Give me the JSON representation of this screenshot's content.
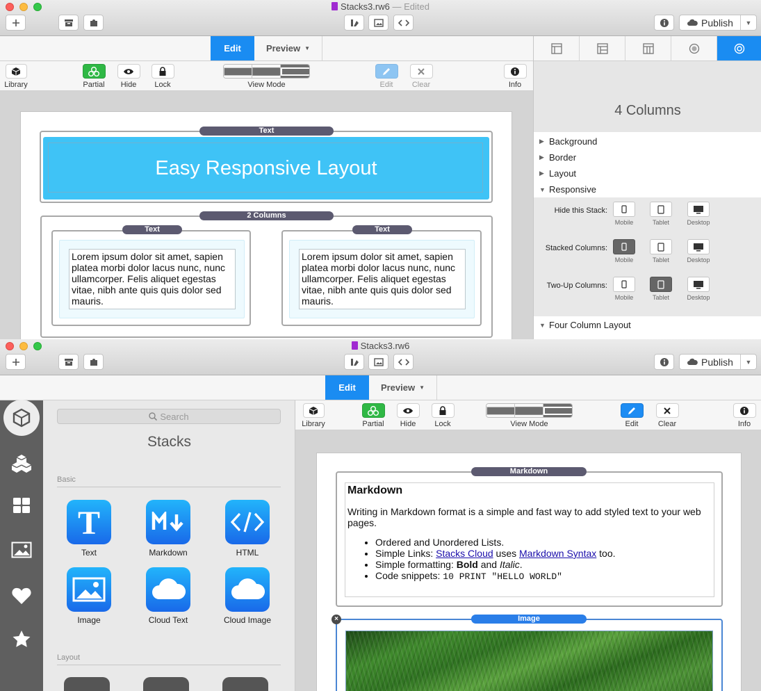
{
  "window1": {
    "title": "Stacks3.rw6",
    "edited": "— Edited",
    "publish": "Publish",
    "tabs": {
      "edit": "Edit",
      "preview": "Preview"
    },
    "toolbar": {
      "library": "Library",
      "partial": "Partial",
      "hide": "Hide",
      "lock": "Lock",
      "view_mode": "View Mode",
      "edit": "Edit",
      "clear": "Clear",
      "info": "Info"
    },
    "canvas": {
      "text_label": "Text",
      "hero_text": "Easy Responsive Layout",
      "columns_label": "2 Columns",
      "col1_label": "Text",
      "col2_label": "Text",
      "lorem": "Lorem ipsum dolor sit amet, sapien platea morbi dolor lacus nunc, nunc ullamcorper. Felis aliquet egestas vitae, nibh ante quis quis dolor sed mauris."
    },
    "inspector": {
      "title": "4 Columns",
      "rows": [
        "Background",
        "Border",
        "Layout",
        "Responsive"
      ],
      "responsive": {
        "hide_label": "Hide this Stack:",
        "stacked_label": "Stacked Columns:",
        "twoup_label": "Two-Up Columns:",
        "mobile": "Mobile",
        "tablet": "Tablet",
        "desktop": "Desktop"
      },
      "four_col": "Four Column Layout"
    }
  },
  "window2": {
    "title": "Stacks3.rw6",
    "publish": "Publish",
    "tabs": {
      "edit": "Edit",
      "preview": "Preview"
    },
    "toolbar": {
      "library": "Library",
      "partial": "Partial",
      "hide": "Hide",
      "lock": "Lock",
      "view_mode": "View Mode",
      "edit": "Edit",
      "clear": "Clear",
      "info": "Info"
    },
    "library": {
      "search_placeholder": "Search",
      "title": "Stacks",
      "basic": "Basic",
      "layout": "Layout",
      "tiles": [
        "Text",
        "Markdown",
        "HTML",
        "Image",
        "Cloud Text",
        "Cloud Image"
      ]
    },
    "canvas": {
      "md_label": "Markdown",
      "md_heading": "Markdown",
      "md_intro": "Writing in Markdown format is a simple and fast way to add styled text to your web pages.",
      "li1": "Ordered and Unordered Lists.",
      "li2_pre": "Simple Links: ",
      "li2_link1": "Stacks Cloud",
      "li2_mid": " uses ",
      "li2_link2": "Markdown Syntax",
      "li2_post": " too.",
      "li3_pre": "Simple formatting: ",
      "li3_bold": "Bold",
      "li3_mid": " and ",
      "li3_italic": "Italic",
      "li3_post": ".",
      "li4_pre": "Code snippets: ",
      "li4_code": "10 PRINT \"HELLO WORLD\"",
      "image_label": "Image"
    }
  }
}
